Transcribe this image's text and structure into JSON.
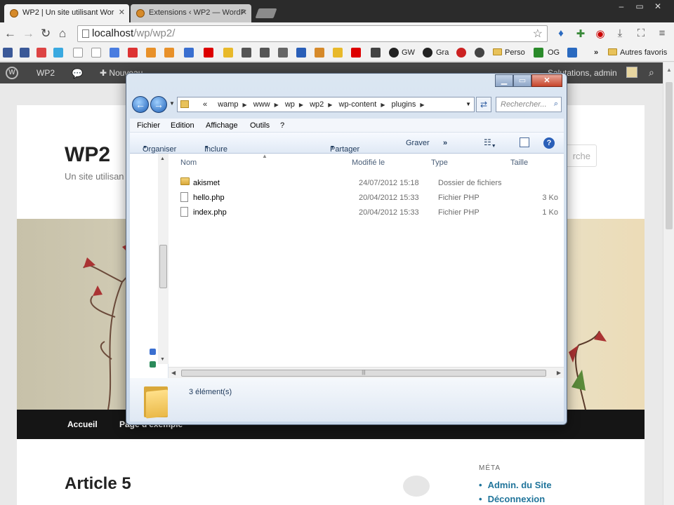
{
  "browser": {
    "tabs": [
      {
        "title": "WP2 | Un site utilisant Wor"
      },
      {
        "title": "Extensions ‹ WP2 — WordP"
      }
    ],
    "url": {
      "host": "localhost",
      "path": "/wp/wp2/"
    },
    "bookmarks": [
      {
        "label": "GW"
      },
      {
        "label": "Gra"
      },
      {
        "label": "Perso"
      },
      {
        "label": "OG"
      },
      {
        "label": "Autres favoris"
      }
    ]
  },
  "wp": {
    "adminbar": {
      "site": "WP2",
      "new": "Nouveau",
      "greeting": "Salutations, admin"
    },
    "site_title": "WP2",
    "site_desc": "Un site utilisan",
    "search_placeholder": "rche",
    "nav": [
      "Accueil",
      "Page d'exemple"
    ],
    "article_title": "Article 5",
    "meta": {
      "title": "MÉTA",
      "links": [
        "Admin. du Site",
        "Déconnexion"
      ]
    }
  },
  "explorer": {
    "breadcrumb": [
      "wamp",
      "www",
      "wp",
      "wp2",
      "wp-content",
      "plugins"
    ],
    "breadcrumb_prefix": "«",
    "search_placeholder": "Rechercher...",
    "menu": [
      "Fichier",
      "Edition",
      "Affichage",
      "Outils",
      "?"
    ],
    "commands": [
      "Organiser",
      "Inclure dans la bibliothèque",
      "Partager avec",
      "Graver",
      "»"
    ],
    "columns": [
      "Nom",
      "Modifié le",
      "Type",
      "Taille"
    ],
    "files": [
      {
        "name": "akismet",
        "modified": "24/07/2012 15:18",
        "type": "Dossier de fichiers",
        "size": "",
        "icon": "folder-icon"
      },
      {
        "name": "hello.php",
        "modified": "20/04/2012 15:33",
        "type": "Fichier PHP",
        "size": "3 Ko",
        "icon": "file-icon"
      },
      {
        "name": "index.php",
        "modified": "20/04/2012 15:33",
        "type": "Fichier PHP",
        "size": "1 Ko",
        "icon": "file-icon"
      }
    ],
    "status": "3 élément(s)"
  }
}
